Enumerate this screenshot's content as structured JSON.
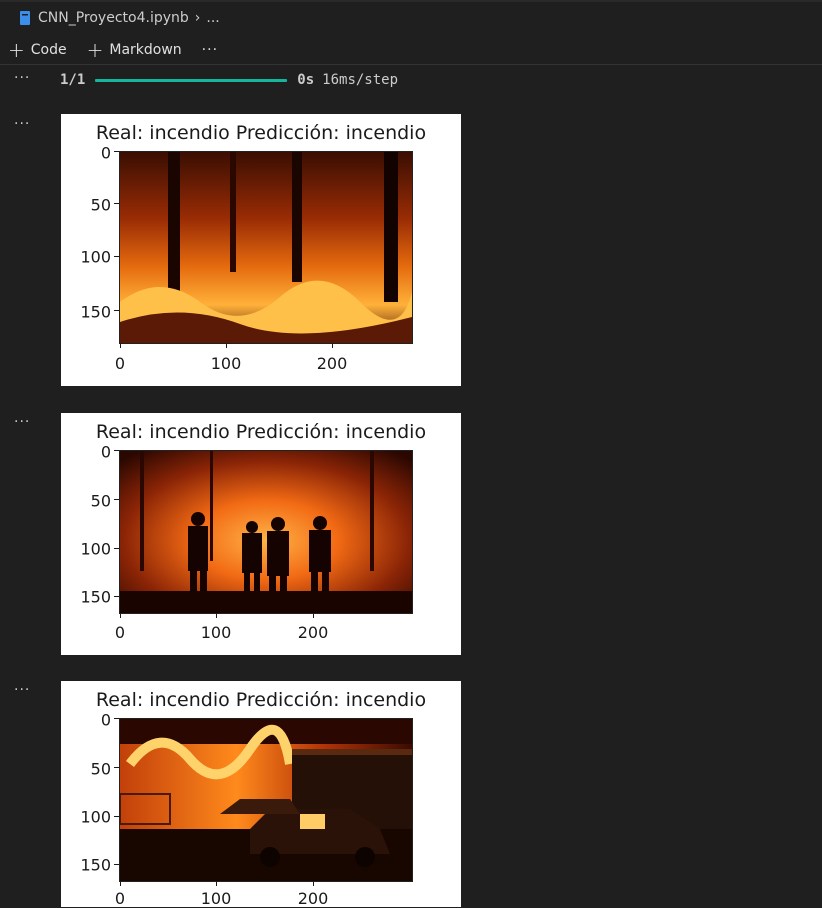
{
  "breadcrumb": {
    "file_name": "CNN_Proyecto4.ipynb",
    "trail": "..."
  },
  "toolbar": {
    "code_label": "Code",
    "markdown_label": "Markdown",
    "more_label": "···"
  },
  "output": {
    "gutter_label": "···",
    "progress": {
      "step": "1/1",
      "time": "0s",
      "rate": "16ms/step",
      "fraction": 1.0
    }
  },
  "plots": [
    {
      "title": "Real: incendio  Predicción: incendio",
      "yticks": [
        "0",
        "50",
        "100",
        "150"
      ],
      "xticks": [
        "0",
        "100",
        "200"
      ],
      "image": "forest-fire-trees"
    },
    {
      "title": "Real: incendio  Predicción: incendio",
      "yticks": [
        "0",
        "50",
        "100",
        "150"
      ],
      "xticks": [
        "0",
        "100",
        "200"
      ],
      "image": "firefighters-silhouette"
    },
    {
      "title": "Real: incendio  Predicción: incendio",
      "yticks": [
        "0",
        "50",
        "100",
        "150"
      ],
      "xticks": [
        "0",
        "100",
        "200"
      ],
      "image": "burning-house-car"
    }
  ],
  "colors": {
    "background": "#1f1f1f",
    "progress_bar": "#15b79c",
    "text": "#cccccc"
  }
}
